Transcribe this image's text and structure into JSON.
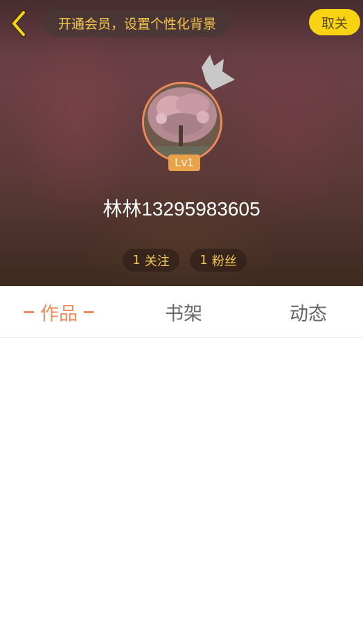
{
  "header": {
    "promo_text": "开通会员，设置个性化背景",
    "close_label": "取关"
  },
  "profile": {
    "level": "Lv1",
    "username": "林林13295983605",
    "following_count": "1",
    "following_label": "关注",
    "fans_count": "1",
    "fans_label": "粉丝"
  },
  "tabs": [
    {
      "label": "作品",
      "active": true
    },
    {
      "label": "书架",
      "active": false
    },
    {
      "label": "动态",
      "active": false
    }
  ],
  "colors": {
    "accent": "#ef8a5a",
    "promo_text": "#f5c84a",
    "close_button": "#f7d313"
  }
}
